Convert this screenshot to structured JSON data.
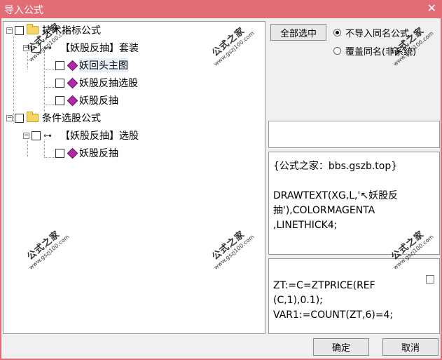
{
  "window": {
    "title": "导入公式"
  },
  "tree": {
    "groups": [
      {
        "label": "技术指标公式",
        "children": [
          {
            "label": "【妖股反抽】套装",
            "children": [
              {
                "label": "妖回头主图"
              },
              {
                "label": "妖股反抽选股"
              },
              {
                "label": "妖股反抽"
              }
            ]
          }
        ]
      },
      {
        "label": "条件选股公式",
        "children": [
          {
            "label": "【妖股反抽】选股",
            "children": [
              {
                "label": "妖股反抽"
              }
            ]
          }
        ]
      }
    ]
  },
  "controls": {
    "select_all": "全部选中",
    "radio_no_import": "不导入同名公式",
    "radio_overwrite": "覆盖同名(非系统)"
  },
  "description": "{公式之家：bbs.gszb.top}\n\nDRAWTEXT(XG,L,'↖妖股反抽'),COLORMAGENTA\n,LINETHICK4;",
  "code": "ZT:=C=ZTPRICE(REF\n(C,1),0.1);\nVAR1:=COUNT(ZT,6)=4;",
  "buttons": {
    "ok": "确定",
    "cancel": "取消"
  },
  "watermark": {
    "cn": "公式之家",
    "en": "www.gszj100.com"
  }
}
